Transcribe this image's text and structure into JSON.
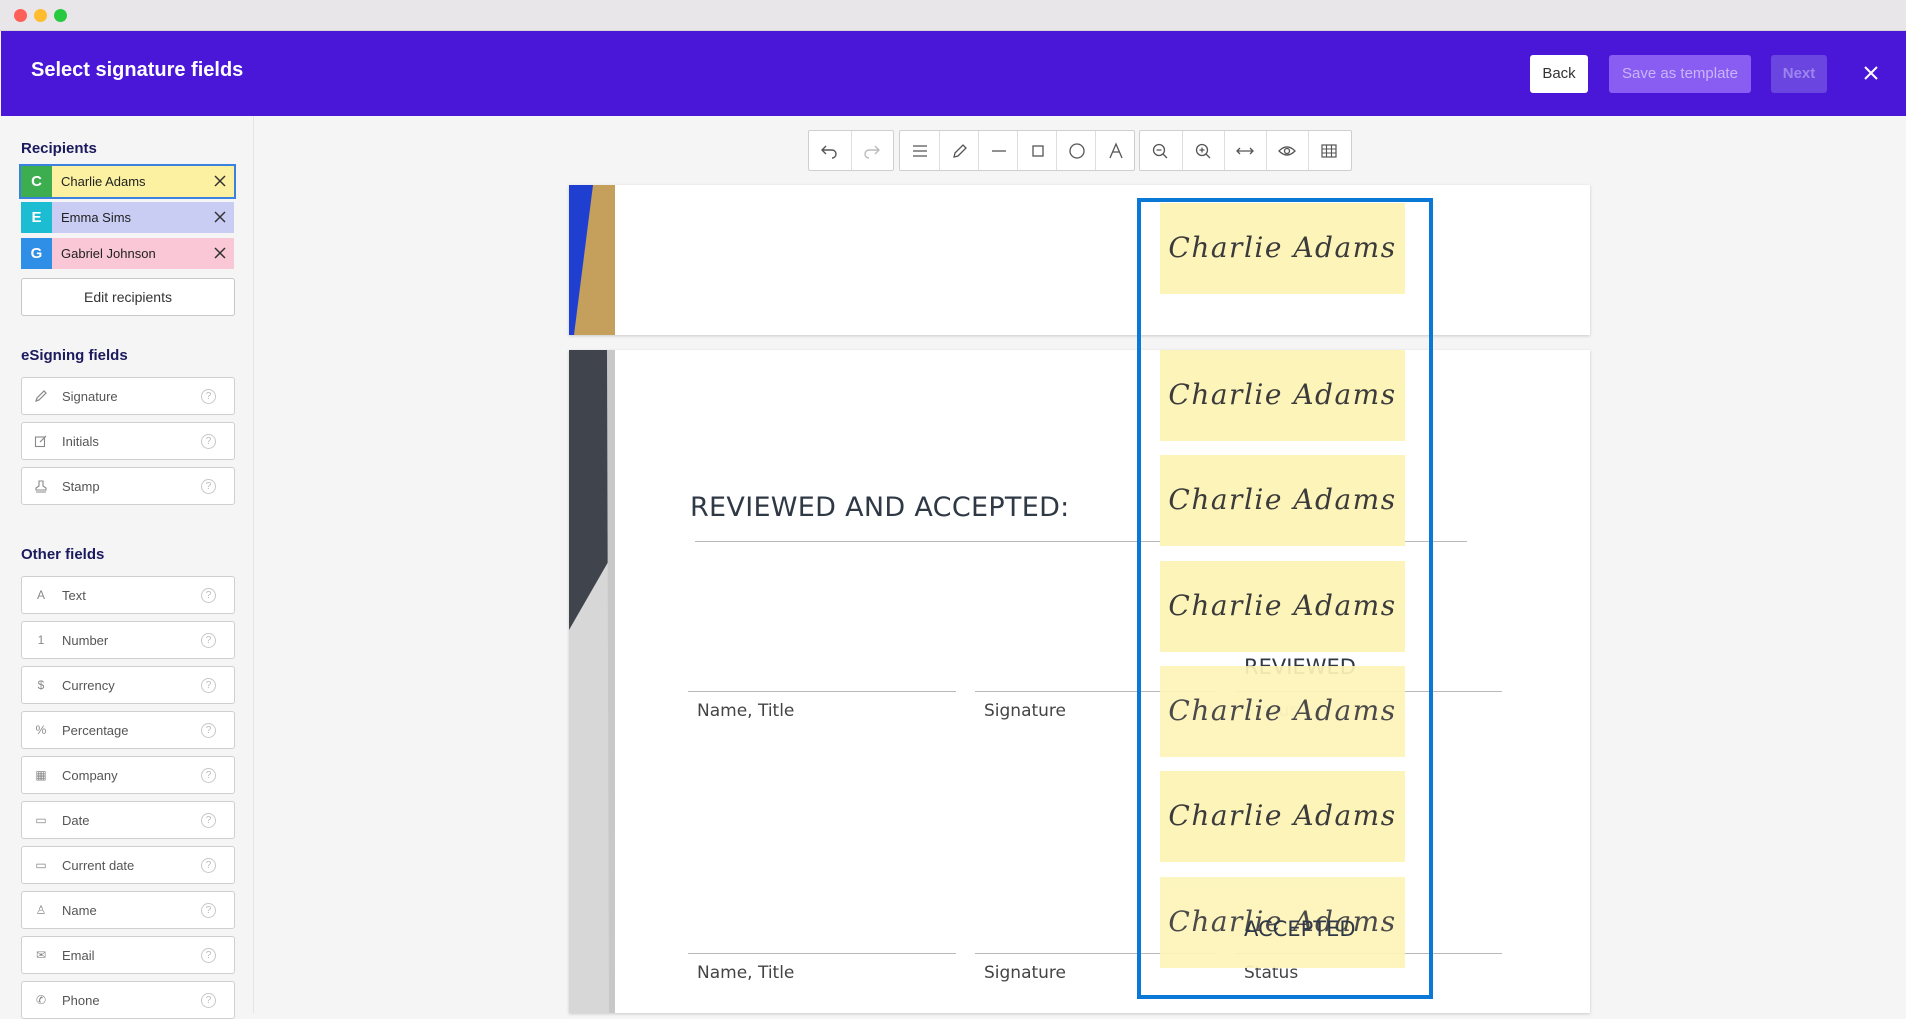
{
  "header": {
    "title": "Select signature fields",
    "back_label": "Back",
    "save_template_label": "Save as template",
    "next_label": "Next"
  },
  "sidebar": {
    "recipients_title": "Recipients",
    "recipients": [
      {
        "initial": "C",
        "name": "Charlie Adams",
        "avatar_color": "#3dae4f",
        "bg_color": "#fbf1a0"
      },
      {
        "initial": "E",
        "name": "Emma Sims",
        "avatar_color": "#1cbcd2",
        "bg_color": "#c9cdf4"
      },
      {
        "initial": "G",
        "name": "Gabriel Johnson",
        "avatar_color": "#2f8fe6",
        "bg_color": "#f9c7d6"
      }
    ],
    "edit_recipients_label": "Edit recipients",
    "esigning_title": "eSigning fields",
    "esigning_fields": [
      {
        "label": "Signature",
        "icon": "pen-icon"
      },
      {
        "label": "Initials",
        "icon": "edit-icon"
      },
      {
        "label": "Stamp",
        "icon": "stamp-icon"
      }
    ],
    "other_title": "Other fields",
    "other_fields": [
      {
        "label": "Text",
        "icon": "text-icon",
        "glyph": "A"
      },
      {
        "label": "Number",
        "icon": "number-icon",
        "glyph": "1"
      },
      {
        "label": "Currency",
        "icon": "currency-icon",
        "glyph": "$"
      },
      {
        "label": "Percentage",
        "icon": "percent-icon",
        "glyph": "%"
      },
      {
        "label": "Company",
        "icon": "building-icon",
        "glyph": "▦"
      },
      {
        "label": "Date",
        "icon": "calendar-icon",
        "glyph": "▭"
      },
      {
        "label": "Current date",
        "icon": "calendar-check-icon",
        "glyph": "▭"
      },
      {
        "label": "Name",
        "icon": "person-icon",
        "glyph": "♙"
      },
      {
        "label": "Email",
        "icon": "mail-icon",
        "glyph": "✉"
      },
      {
        "label": "Phone",
        "icon": "phone-icon",
        "glyph": "✆"
      }
    ]
  },
  "document": {
    "heading": "REVIEWED AND ACCEPTED:",
    "label_name_title": "Name, Title",
    "label_signature": "Signature",
    "label_status": "Status",
    "overlay_reviewed": "REVIEWED",
    "overlay_accepted": "ACCEPTED",
    "signature_text": "Charlie Adams"
  },
  "colors": {
    "header_bg": "#4a16d8",
    "selection_border": "#0a78d7",
    "signature_bg": "#fdf4b9"
  }
}
